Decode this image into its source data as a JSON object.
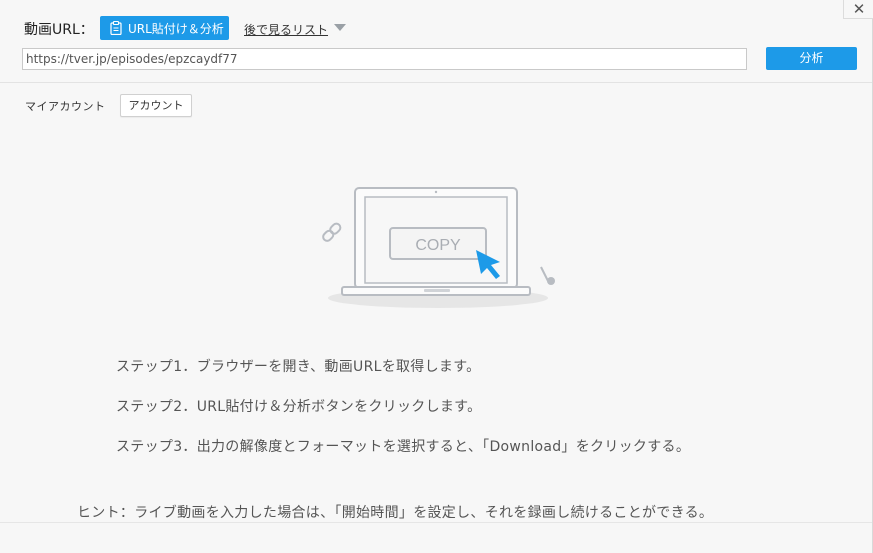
{
  "header": {
    "url_label": "動画URL：",
    "paste_button_label": "URL貼付け＆分析",
    "watch_later_label": "後で見るリスト",
    "url_value": "https://tver.jp/episodes/epzcaydf77",
    "analyze_button_label": "分析",
    "close_glyph": "✕"
  },
  "account": {
    "label": "マイアカウント",
    "button_label": "アカウント"
  },
  "illustration": {
    "copy_text": "COPY"
  },
  "steps": [
    "ステップ1．ブラウザーを開き、動画URLを取得します。",
    "ステップ2．URL貼付け＆分析ボタンをクリックします。",
    "ステップ3．出力の解像度とフォーマットを選択すると、「Download」をクリックする。"
  ],
  "hint": "ヒント：ライブ動画を入力した場合は、「開始時間」を設定し、それを録画し続けることができる。",
  "colors": {
    "accent": "#1d9ae8",
    "background": "#f7f7f7",
    "illustration_gray": "#b8bcc2",
    "cursor_blue": "#1d9ae8"
  },
  "icons": {
    "paste": "clipboard-icon",
    "close": "close-icon",
    "dropdown": "triangle-down-icon",
    "link": "link-icon",
    "music": "music-note-icon",
    "cursor": "cursor-arrow-icon",
    "laptop": "laptop-icon"
  }
}
